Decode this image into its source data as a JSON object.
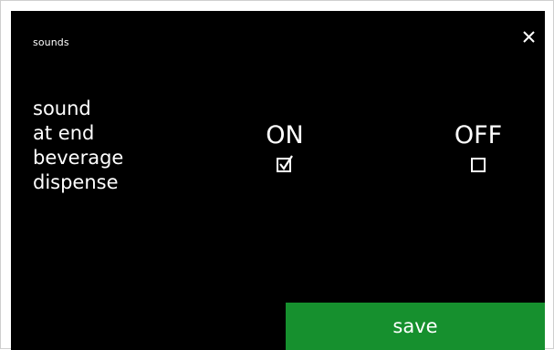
{
  "header": {
    "title": "sounds",
    "close_icon": "close-icon"
  },
  "setting": {
    "label_lines": [
      "sound",
      "at end",
      "beverage",
      "dispense"
    ]
  },
  "options": [
    {
      "label": "ON",
      "checked": true,
      "icon": "checkbox-checked-icon"
    },
    {
      "label": "OFF",
      "checked": false,
      "icon": "checkbox-empty-icon"
    }
  ],
  "footer": {
    "save_label": "save"
  },
  "colors": {
    "screen_background": "#000000",
    "text": "#ffffff",
    "save_button": "#16902e"
  }
}
